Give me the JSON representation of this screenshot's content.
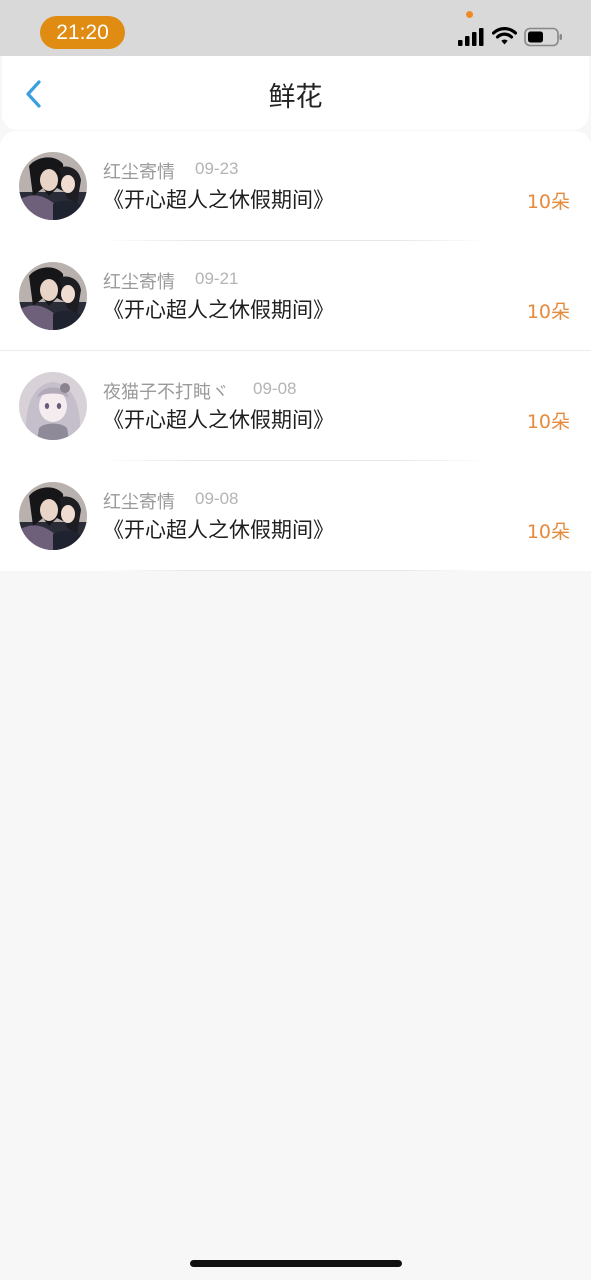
{
  "status_bar": {
    "time": "21:20",
    "icons": [
      "signal-icon",
      "wifi-icon",
      "battery-icon"
    ],
    "accent_color": "#e08b12"
  },
  "header": {
    "title": "鲜花",
    "back_icon": "chevron-left-icon"
  },
  "colors": {
    "count": "#e68a3c",
    "back": "#3a9fe0",
    "background": "#f7f7f7"
  },
  "gifts": [
    {
      "sender": "红尘寄情",
      "date": "09-23",
      "title": "《开心超人之休假期间》",
      "count": "10朵",
      "avatar": "avatar-couple"
    },
    {
      "sender": "红尘寄情",
      "date": "09-21",
      "title": "《开心超人之休假期间》",
      "count": "10朵",
      "avatar": "avatar-couple"
    },
    {
      "sender": "夜猫子不打盹ヾ",
      "date": "09-08",
      "title": "《开心超人之休假期间》",
      "count": "10朵",
      "avatar": "avatar-anime-girl"
    },
    {
      "sender": "红尘寄情",
      "date": "09-08",
      "title": "《开心超人之休假期间》",
      "count": "10朵",
      "avatar": "avatar-couple"
    }
  ]
}
